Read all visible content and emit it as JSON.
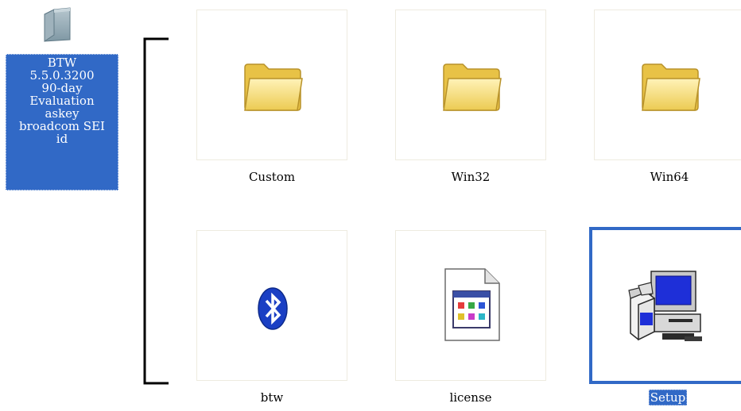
{
  "parent_folder": {
    "icon": "folder-icon",
    "label": "BTW\n5.5.0.3200\n90-day\nEvaluation\naskey\nbroadcom SEI\nid"
  },
  "items": [
    {
      "name": "Custom",
      "icon": "folder-icon"
    },
    {
      "name": "Win32",
      "icon": "folder-icon"
    },
    {
      "name": "Win64",
      "icon": "folder-icon"
    },
    {
      "name": "btw",
      "icon": "bluetooth-icon"
    },
    {
      "name": "license",
      "icon": "document-icon"
    },
    {
      "name": "Setup",
      "icon": "setup-installer-icon",
      "selected": true
    }
  ],
  "colors": {
    "selection": "#3169c6",
    "folder_yellow": "#f5d76e",
    "bluetooth_blue": "#1a3fc4"
  }
}
